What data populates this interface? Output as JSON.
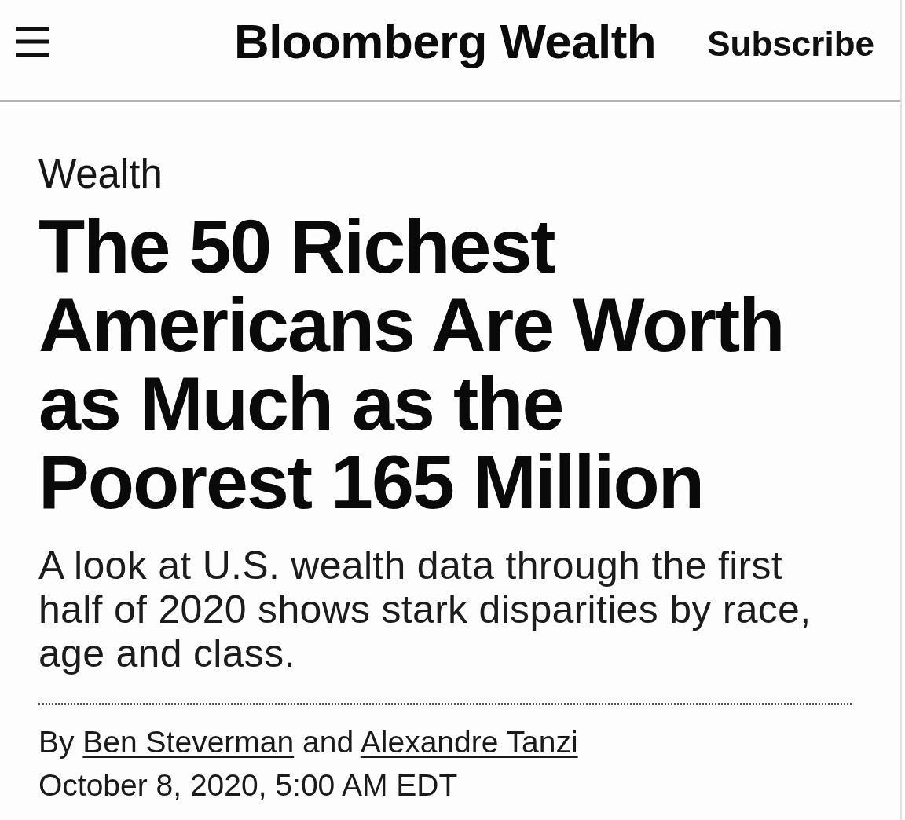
{
  "header": {
    "title": "Bloomberg Wealth",
    "subscribe": "Subscribe"
  },
  "article": {
    "section": "Wealth",
    "headline": "The 50 Richest Americans Are Worth as Much as the Poorest 165 Million",
    "deck": "A look at U.S. wealth data through the first half of 2020 shows stark disparities by race, age and class.",
    "byline": {
      "prefix": "By",
      "authors": [
        "Ben Steverman",
        "Alexandre Tanzi"
      ],
      "joiner": "and"
    },
    "timestamp": "October 8, 2020, 5:00 AM EDT"
  }
}
